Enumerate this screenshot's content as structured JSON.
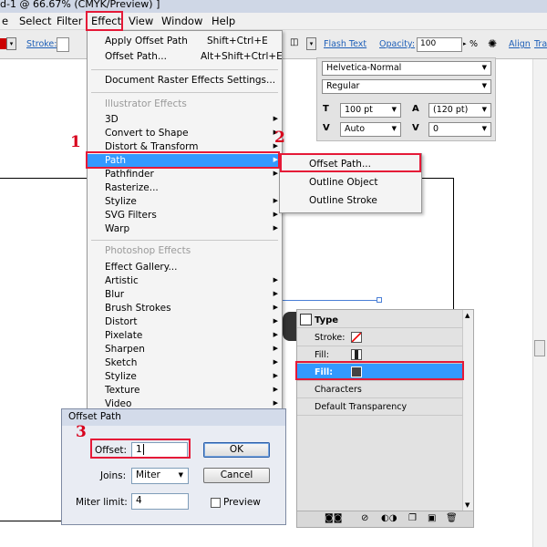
{
  "window": {
    "title": "d-1 @ 66.67% (CMYK/Preview) ]"
  },
  "menubar": {
    "items": [
      {
        "label": "e"
      },
      {
        "label": "Select"
      },
      {
        "label": "Filter"
      },
      {
        "label": "Effect"
      },
      {
        "label": "View"
      },
      {
        "label": "Window"
      },
      {
        "label": "Help"
      }
    ]
  },
  "control_bar": {
    "stroke_label": "Stroke:",
    "flash_text": "Flash Text",
    "opacity_label": "Opacity:",
    "opacity_value": "100",
    "opacity_unit": "%",
    "align_label": "Align",
    "tra_label": "Tra"
  },
  "character_panel": {
    "font_family": "Helvetica-Normal",
    "font_style": "Regular",
    "font_size": "100 pt",
    "leading": "(120 pt)",
    "kerning": "Auto",
    "tracking": "0"
  },
  "effect_menu": {
    "top_items": [
      {
        "label": "Apply Offset Path",
        "shortcut": "Shift+Ctrl+E"
      },
      {
        "label": "Offset Path...",
        "shortcut": "Alt+Shift+Ctrl+E"
      }
    ],
    "raster_settings": "Document Raster Effects Settings...",
    "illustrator_header": "Illustrator Effects",
    "illustrator_items": [
      "3D",
      "Convert to Shape",
      "Distort & Transform",
      "Path",
      "Pathfinder",
      "Rasterize...",
      "Stylize",
      "SVG Filters",
      "Warp"
    ],
    "photoshop_header": "Photoshop Effects",
    "photoshop_items": [
      "Effect Gallery...",
      "Artistic",
      "Blur",
      "Brush Strokes",
      "Distort",
      "Pixelate",
      "Sharpen",
      "Sketch",
      "Stylize",
      "Texture",
      "Video"
    ]
  },
  "path_submenu": {
    "items": [
      "Offset Path...",
      "Outline Object",
      "Outline Stroke"
    ]
  },
  "appearance_panel": {
    "type_label": "Type",
    "rows": [
      {
        "label": "Stroke:"
      },
      {
        "label": "Fill:"
      },
      {
        "label": "Fill:"
      },
      {
        "label": "Characters"
      },
      {
        "label": "Default Transparency"
      }
    ]
  },
  "offset_dialog": {
    "title": "Offset Path",
    "offset_label": "Offset:",
    "offset_value": "1",
    "joins_label": "Joins:",
    "joins_value": "Miter",
    "miter_label": "Miter limit:",
    "miter_value": "4",
    "ok_label": "OK",
    "cancel_label": "Cancel",
    "preview_label": "Preview"
  },
  "annotations": {
    "step1": "1",
    "step2": "2",
    "step3": "3"
  },
  "colors": {
    "highlight": "#3399ff",
    "annotation_red": "#e51937",
    "step_red": "#d8001c"
  }
}
